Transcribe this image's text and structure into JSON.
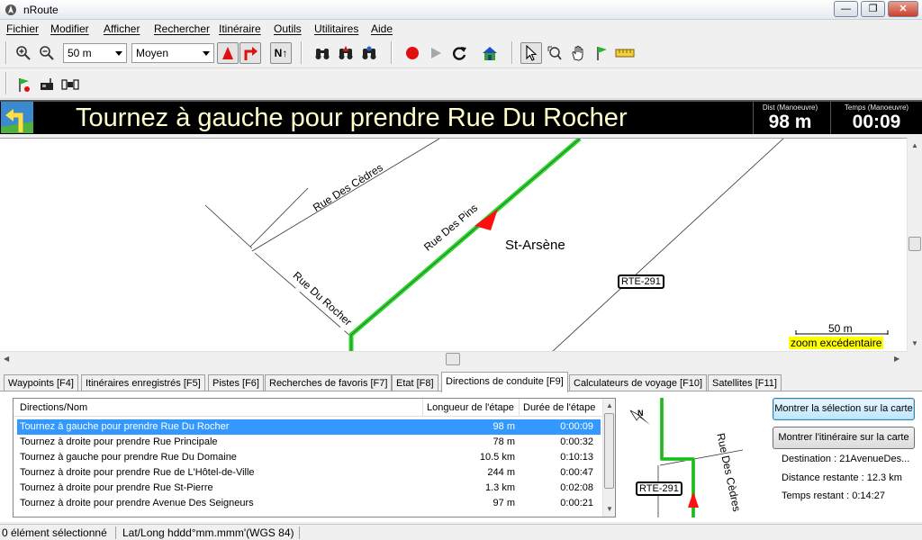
{
  "window": {
    "title": "nRoute"
  },
  "menu": [
    "Fichier",
    "Modifier",
    "Afficher",
    "Rechercher",
    "Itinéraire",
    "Outils",
    "Utilitaires",
    "Aide"
  ],
  "toolbar": {
    "zoom_value": "50 m",
    "detail_value": "Moyen",
    "north_label": "N↑"
  },
  "banner": {
    "instruction": "Tournez à gauche pour prendre Rue Du Rocher",
    "dist_label": "Dist (Manoeuvre)",
    "dist_value": "98 m",
    "time_label": "Temps (Manoeuvre)",
    "time_value": "00:09"
  },
  "map": {
    "labels": {
      "rue_cedres": "Rue Des Cèdres",
      "rue_pins": "Rue Des Pins",
      "rue_rocher": "Rue Du Rocher",
      "town": "St-Arsène",
      "route_shield": "RTE-291"
    },
    "scale_label": "50 m",
    "zoom_warning": "zoom excédentaire"
  },
  "tabs": [
    "Waypoints [F4]",
    "Itinéraires enregistrés [F5]",
    "Pistes [F6]",
    "Recherches de favoris [F7]",
    "Etat [F8]",
    "Directions de conduite [F9]",
    "Calculateurs de voyage [F10]",
    "Satellites [F11]"
  ],
  "directions": {
    "headers": [
      "Directions/Nom",
      "Longueur de l'étape",
      "Durée de l'étape"
    ],
    "rows": [
      {
        "name": "Tournez à gauche pour prendre Rue Du Rocher",
        "length": "98 m",
        "duration": "0:00:09"
      },
      {
        "name": "Tournez à droite pour prendre Rue Principale",
        "length": "78 m",
        "duration": "0:00:32"
      },
      {
        "name": "Tournez à gauche pour prendre Rue Du Domaine",
        "length": "10.5 km",
        "duration": "0:10:13"
      },
      {
        "name": "Tournez à droite pour prendre Rue de L'Hôtel-de-Ville",
        "length": "244 m",
        "duration": "0:00:47"
      },
      {
        "name": "Tournez à droite pour prendre Rue St-Pierre",
        "length": "1.3 km",
        "duration": "0:02:08"
      },
      {
        "name": "Tournez à droite pour prendre Avenue Des Seigneurs",
        "length": "97 m",
        "duration": "0:00:21"
      }
    ]
  },
  "minimap": {
    "route_shield": "RTE-291",
    "street": "Rue Des Cèdres",
    "north": "N"
  },
  "actions": {
    "show_selection": "Montrer la sélection sur la carte",
    "show_route": "Montrer l'itinéraire sur la carte"
  },
  "info": {
    "destination": "Destination : 21AvenueDes...",
    "distance": "Distance restante : 12.3 km",
    "time": "Temps restant : 0:14:27"
  },
  "status": {
    "selection": "0 élément sélectionné",
    "coords": "Lat/Long hddd°mm.mmm'(WGS 84)"
  },
  "colors": {
    "route": "#22dd22",
    "banner_text": "#ffffcc",
    "selection": "#3399ff",
    "zoom_warning_bg": "#ffff00"
  }
}
